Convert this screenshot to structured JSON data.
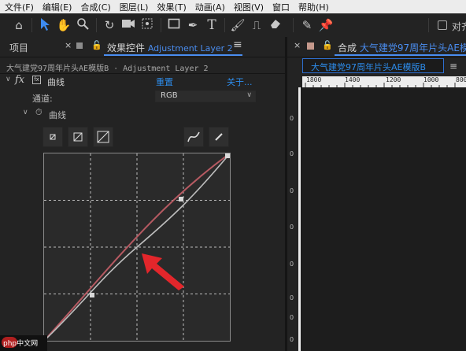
{
  "menu": [
    "文件(F)",
    "编辑(E)",
    "合成(C)",
    "图层(L)",
    "效果(T)",
    "动画(A)",
    "视图(V)",
    "窗口",
    "帮助(H)"
  ],
  "toolbar": {
    "snap_label": "对齐"
  },
  "left_panel": {
    "project_tab": "项目",
    "effect_controls_tab_prefix": "效果控件",
    "effect_controls_tab_layer": "Adjustment Layer 2",
    "breadcrumb": "大气建党97周年片头AE模版B · Adjustment Layer 2",
    "effect_name": "曲线",
    "reset_label": "重置",
    "about_label": "关于...",
    "channel_label": "通道:",
    "channel_value": "RGB",
    "curves_property": "曲线"
  },
  "right_panel": {
    "comp_tab_prefix": "合成",
    "comp_tab_name": "大气建党97周年片头AE模",
    "comp_subtab": "大气建党97周年片头AE模版B",
    "ruler_ticks": [
      "1800",
      "1400",
      "1200",
      "1000",
      "800"
    ],
    "vruler_ticks": [
      "0",
      "0",
      "0",
      "0",
      "0",
      "0",
      "0",
      "0"
    ]
  },
  "watermark": {
    "text": "php中文网"
  },
  "colors": {
    "accent_blue": "#2d8ceb",
    "arrow_red": "#e3262b",
    "curve_red": "#b65a62"
  }
}
